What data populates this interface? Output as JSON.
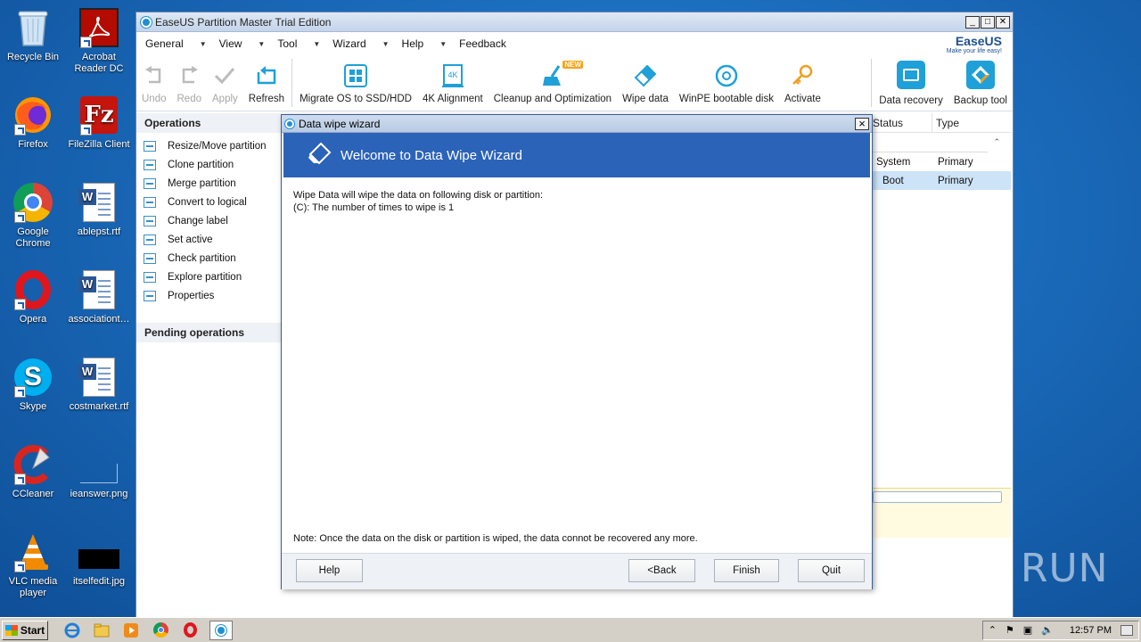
{
  "desktop": {
    "icons": [
      {
        "label": "Recycle Bin",
        "icon": "recycle-bin-icon"
      },
      {
        "label": "Acrobat Reader DC",
        "icon": "acrobat-icon"
      },
      {
        "label": "Firefox",
        "icon": "firefox-icon"
      },
      {
        "label": "FileZilla Client",
        "icon": "filezilla-icon"
      },
      {
        "label": "Google Chrome",
        "icon": "chrome-icon"
      },
      {
        "label": "ablepst.rtf",
        "icon": "word-doc-icon"
      },
      {
        "label": "Opera",
        "icon": "opera-icon"
      },
      {
        "label": "associationt…",
        "icon": "word-doc-icon"
      },
      {
        "label": "Skype",
        "icon": "skype-icon"
      },
      {
        "label": "costmarket.rtf",
        "icon": "word-doc-icon"
      },
      {
        "label": "CCleaner",
        "icon": "ccleaner-icon"
      },
      {
        "label": "ieanswer.png",
        "icon": "image-file-icon"
      },
      {
        "label": "VLC media player",
        "icon": "vlc-icon"
      },
      {
        "label": "itselfedit.jpg",
        "icon": "image-file-icon"
      }
    ]
  },
  "app": {
    "title": "EaseUS Partition Master Trial Edition",
    "menu": [
      "General",
      "View",
      "Tool",
      "Wizard",
      "Help",
      "Feedback"
    ],
    "brand": {
      "name": "EaseUS",
      "tagline": "Make your life easy!"
    },
    "toolbar": {
      "undo": "Undo",
      "redo": "Redo",
      "apply": "Apply",
      "refresh": "Refresh",
      "migrate": "Migrate OS to SSD/HDD",
      "align": "4K Alignment",
      "cleanup": "Cleanup and Optimization",
      "new_badge": "NEW",
      "wipe": "Wipe data",
      "winpe": "WinPE bootable disk",
      "activate": "Activate",
      "recovery": "Data recovery",
      "backup": "Backup tool"
    },
    "operations_title": "Operations",
    "operations": [
      "Resize/Move partition",
      "Clone partition",
      "Merge partition",
      "Convert to logical",
      "Change label",
      "Set active",
      "Check partition",
      "Explore partition",
      "Properties"
    ],
    "pending_title": "Pending operations",
    "table": {
      "headers": [
        "Status",
        "Type"
      ],
      "rows": [
        {
          "status": "System",
          "type": "Primary"
        },
        {
          "status": "Boot",
          "type": "Primary"
        }
      ]
    }
  },
  "dialog": {
    "title": "Data wipe wizard",
    "heading": "Welcome to Data Wipe Wizard",
    "line1": "Wipe Data will wipe the data on following disk or partition:",
    "line2": "(C): The number of times to wipe is 1",
    "note": "Note: Once the data on the disk or partition is wiped, the data connot be recovered any more.",
    "buttons": {
      "help": "Help",
      "back": "<Back",
      "finish": "Finish",
      "quit": "Quit"
    }
  },
  "watermark": "ANY RUN",
  "taskbar": {
    "start": "Start",
    "clock": "12:57 PM"
  },
  "colors": {
    "accent": "#2b63b8",
    "icon_blue": "#1fa0d8"
  }
}
